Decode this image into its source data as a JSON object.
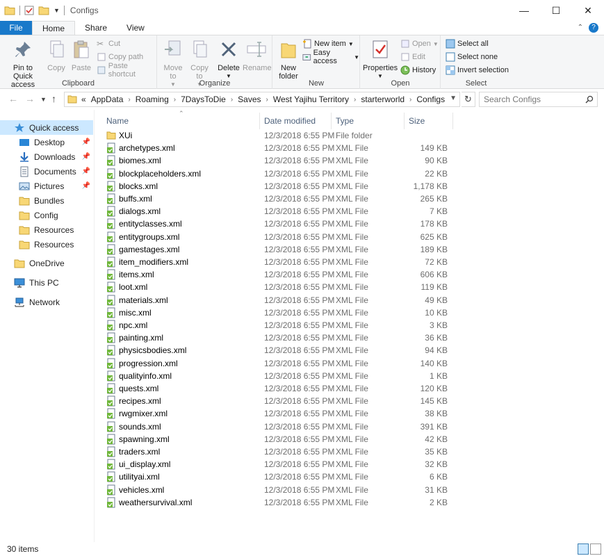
{
  "window": {
    "title": "Configs"
  },
  "tabs": [
    {
      "label": "File"
    },
    {
      "label": "Home"
    },
    {
      "label": "Share"
    },
    {
      "label": "View"
    }
  ],
  "ribbon": {
    "clipboard": {
      "label": "Clipboard",
      "pin": "Pin to Quick access",
      "copy": "Copy",
      "paste": "Paste",
      "cut": "Cut",
      "copy_path": "Copy path",
      "paste_shortcut": "Paste shortcut"
    },
    "organize": {
      "label": "Organize",
      "move_to": "Move to",
      "copy_to": "Copy to",
      "delete": "Delete",
      "rename": "Rename"
    },
    "new": {
      "label": "New",
      "new_folder": "New folder",
      "new_item": "New item",
      "easy_access": "Easy access"
    },
    "open": {
      "label": "Open",
      "properties": "Properties",
      "open": "Open",
      "edit": "Edit",
      "history": "History"
    },
    "select": {
      "label": "Select",
      "select_all": "Select all",
      "select_none": "Select none",
      "invert": "Invert selection"
    }
  },
  "address": {
    "overflow": "«",
    "crumbs": [
      "AppData",
      "Roaming",
      "7DaysToDie",
      "Saves",
      "West Yajihu Territory",
      "starterworld",
      "Configs"
    ]
  },
  "search": {
    "placeholder": "Search Configs"
  },
  "nav": {
    "quick_access": "Quick access",
    "pinned": [
      "Desktop",
      "Downloads",
      "Documents",
      "Pictures"
    ],
    "folders": [
      "Bundles",
      "Config",
      "Resources",
      "Resources"
    ],
    "onedrive": "OneDrive",
    "thispc": "This PC",
    "network": "Network"
  },
  "columns": {
    "name": "Name",
    "date": "Date modified",
    "type": "Type",
    "size": "Size"
  },
  "files": [
    {
      "name": "XUi",
      "date": "12/3/2018 6:55 PM",
      "type": "File folder",
      "size": "",
      "kind": "folder"
    },
    {
      "name": "archetypes.xml",
      "date": "12/3/2018 6:55 PM",
      "type": "XML File",
      "size": "149 KB",
      "kind": "xml"
    },
    {
      "name": "biomes.xml",
      "date": "12/3/2018 6:55 PM",
      "type": "XML File",
      "size": "90 KB",
      "kind": "xml"
    },
    {
      "name": "blockplaceholders.xml",
      "date": "12/3/2018 6:55 PM",
      "type": "XML File",
      "size": "22 KB",
      "kind": "xml"
    },
    {
      "name": "blocks.xml",
      "date": "12/3/2018 6:55 PM",
      "type": "XML File",
      "size": "1,178 KB",
      "kind": "xml"
    },
    {
      "name": "buffs.xml",
      "date": "12/3/2018 6:55 PM",
      "type": "XML File",
      "size": "265 KB",
      "kind": "xml"
    },
    {
      "name": "dialogs.xml",
      "date": "12/3/2018 6:55 PM",
      "type": "XML File",
      "size": "7 KB",
      "kind": "xml"
    },
    {
      "name": "entityclasses.xml",
      "date": "12/3/2018 6:55 PM",
      "type": "XML File",
      "size": "178 KB",
      "kind": "xml"
    },
    {
      "name": "entitygroups.xml",
      "date": "12/3/2018 6:55 PM",
      "type": "XML File",
      "size": "625 KB",
      "kind": "xml"
    },
    {
      "name": "gamestages.xml",
      "date": "12/3/2018 6:55 PM",
      "type": "XML File",
      "size": "189 KB",
      "kind": "xml"
    },
    {
      "name": "item_modifiers.xml",
      "date": "12/3/2018 6:55 PM",
      "type": "XML File",
      "size": "72 KB",
      "kind": "xml"
    },
    {
      "name": "items.xml",
      "date": "12/3/2018 6:55 PM",
      "type": "XML File",
      "size": "606 KB",
      "kind": "xml"
    },
    {
      "name": "loot.xml",
      "date": "12/3/2018 6:55 PM",
      "type": "XML File",
      "size": "119 KB",
      "kind": "xml"
    },
    {
      "name": "materials.xml",
      "date": "12/3/2018 6:55 PM",
      "type": "XML File",
      "size": "49 KB",
      "kind": "xml"
    },
    {
      "name": "misc.xml",
      "date": "12/3/2018 6:55 PM",
      "type": "XML File",
      "size": "10 KB",
      "kind": "xml"
    },
    {
      "name": "npc.xml",
      "date": "12/3/2018 6:55 PM",
      "type": "XML File",
      "size": "3 KB",
      "kind": "xml"
    },
    {
      "name": "painting.xml",
      "date": "12/3/2018 6:55 PM",
      "type": "XML File",
      "size": "36 KB",
      "kind": "xml"
    },
    {
      "name": "physicsbodies.xml",
      "date": "12/3/2018 6:55 PM",
      "type": "XML File",
      "size": "94 KB",
      "kind": "xml"
    },
    {
      "name": "progression.xml",
      "date": "12/3/2018 6:55 PM",
      "type": "XML File",
      "size": "140 KB",
      "kind": "xml"
    },
    {
      "name": "qualityinfo.xml",
      "date": "12/3/2018 6:55 PM",
      "type": "XML File",
      "size": "1 KB",
      "kind": "xml"
    },
    {
      "name": "quests.xml",
      "date": "12/3/2018 6:55 PM",
      "type": "XML File",
      "size": "120 KB",
      "kind": "xml"
    },
    {
      "name": "recipes.xml",
      "date": "12/3/2018 6:55 PM",
      "type": "XML File",
      "size": "145 KB",
      "kind": "xml"
    },
    {
      "name": "rwgmixer.xml",
      "date": "12/3/2018 6:55 PM",
      "type": "XML File",
      "size": "38 KB",
      "kind": "xml"
    },
    {
      "name": "sounds.xml",
      "date": "12/3/2018 6:55 PM",
      "type": "XML File",
      "size": "391 KB",
      "kind": "xml"
    },
    {
      "name": "spawning.xml",
      "date": "12/3/2018 6:55 PM",
      "type": "XML File",
      "size": "42 KB",
      "kind": "xml"
    },
    {
      "name": "traders.xml",
      "date": "12/3/2018 6:55 PM",
      "type": "XML File",
      "size": "35 KB",
      "kind": "xml"
    },
    {
      "name": "ui_display.xml",
      "date": "12/3/2018 6:55 PM",
      "type": "XML File",
      "size": "32 KB",
      "kind": "xml"
    },
    {
      "name": "utilityai.xml",
      "date": "12/3/2018 6:55 PM",
      "type": "XML File",
      "size": "6 KB",
      "kind": "xml"
    },
    {
      "name": "vehicles.xml",
      "date": "12/3/2018 6:55 PM",
      "type": "XML File",
      "size": "31 KB",
      "kind": "xml"
    },
    {
      "name": "weathersurvival.xml",
      "date": "12/3/2018 6:55 PM",
      "type": "XML File",
      "size": "2 KB",
      "kind": "xml"
    }
  ],
  "status": {
    "items": "30 items"
  },
  "colors": {
    "accent": "#1979ca",
    "selection": "#cce8ff",
    "folder": "#f8d775"
  }
}
